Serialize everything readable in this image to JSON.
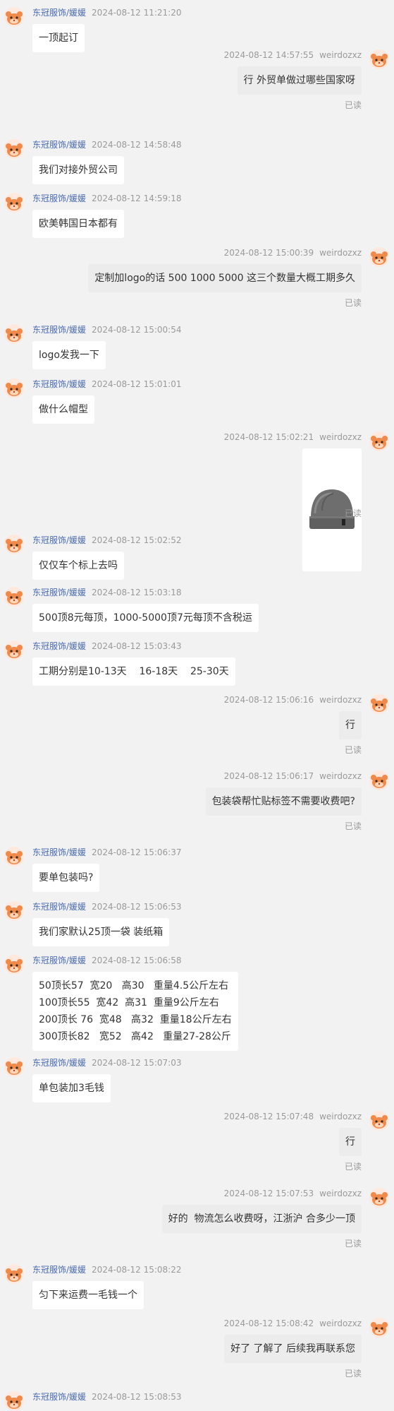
{
  "messages": [
    {
      "dir": "in",
      "name": "东冠服饰/媛媛",
      "time": "2024-08-12 11:21:20",
      "text": "一顶起订"
    },
    {
      "dir": "out",
      "name": "weirdozxz",
      "time": "2024-08-12 14:57:55",
      "text": "行 外贸单做过哪些国家呀",
      "read": "已读"
    },
    {
      "dir": "in",
      "name": "东冠服饰/媛媛",
      "time": "2024-08-12 14:58:48",
      "text": "我们对接外贸公司"
    },
    {
      "dir": "in",
      "name": "东冠服饰/媛媛",
      "time": "2024-08-12 14:59:18",
      "text": "欧美韩国日本都有"
    },
    {
      "dir": "out",
      "name": "weirdozxz",
      "time": "2024-08-12 15:00:39",
      "text": "定制加logo的话 500 1000 5000 这三个数量大概工期多久",
      "read": "已读"
    },
    {
      "dir": "in",
      "name": "东冠服饰/媛媛",
      "time": "2024-08-12 15:00:54",
      "text": "logo发我一下"
    },
    {
      "dir": "in",
      "name": "东冠服饰/媛媛",
      "time": "2024-08-12 15:01:01",
      "text": "做什么帽型"
    },
    {
      "dir": "out",
      "name": "weirdozxz",
      "time": "2024-08-12 15:02:21",
      "image": "beanie-hat-photo",
      "read": "已读"
    },
    {
      "dir": "in",
      "name": "东冠服饰/媛媛",
      "time": "2024-08-12 15:02:52",
      "text": "仅仅车个标上去吗"
    },
    {
      "dir": "in",
      "name": "东冠服饰/媛媛",
      "time": "2024-08-12 15:03:18",
      "text": "500顶8元每顶，1000-5000顶7元每顶不含税运"
    },
    {
      "dir": "in",
      "name": "东冠服饰/媛媛",
      "time": "2024-08-12 15:03:43",
      "text": "工期分别是10-13天    16-18天    25-30天"
    },
    {
      "dir": "out",
      "name": "weirdozxz",
      "time": "2024-08-12 15:06:16",
      "text": "行",
      "read": "已读"
    },
    {
      "dir": "out",
      "name": "weirdozxz",
      "time": "2024-08-12 15:06:17",
      "text": "包装袋帮忙贴标签不需要收费吧?",
      "read": "已读"
    },
    {
      "dir": "in",
      "name": "东冠服饰/媛媛",
      "time": "2024-08-12 15:06:37",
      "text": "要单包装吗?"
    },
    {
      "dir": "in",
      "name": "东冠服饰/媛媛",
      "time": "2024-08-12 15:06:53",
      "text": "我们家默认25顶一袋 装纸箱"
    },
    {
      "dir": "in",
      "name": "东冠服饰/媛媛",
      "time": "2024-08-12 15:06:58",
      "text": "50顶长57  宽20   高30   重量4.5公斤左右\n100顶长55  宽42  高31  重量9公斤左右\n200顶长 76  宽48   高32  重量18公斤左右\n300顶长82   宽52   高42   重量27-28公斤"
    },
    {
      "dir": "in",
      "name": "东冠服饰/媛媛",
      "time": "2024-08-12 15:07:03",
      "text": "单包装加3毛钱"
    },
    {
      "dir": "out",
      "name": "weirdozxz",
      "time": "2024-08-12 15:07:48",
      "text": "行",
      "read": "已读"
    },
    {
      "dir": "out",
      "name": "weirdozxz",
      "time": "2024-08-12 15:07:53",
      "text": "好的  物流怎么收费呀，江浙沪 合多少一顶",
      "read": "已读"
    },
    {
      "dir": "in",
      "name": "东冠服饰/媛媛",
      "time": "2024-08-12 15:08:22",
      "text": "匀下来运费一毛钱一个"
    },
    {
      "dir": "out",
      "name": "weirdozxz",
      "time": "2024-08-12 15:08:42",
      "text": "好了 了解了 后续我再联系您",
      "read": "已读"
    },
    {
      "dir": "in",
      "name": "东冠服饰/媛媛",
      "time": "2024-08-12 15:08:53",
      "text": ""
    }
  ]
}
